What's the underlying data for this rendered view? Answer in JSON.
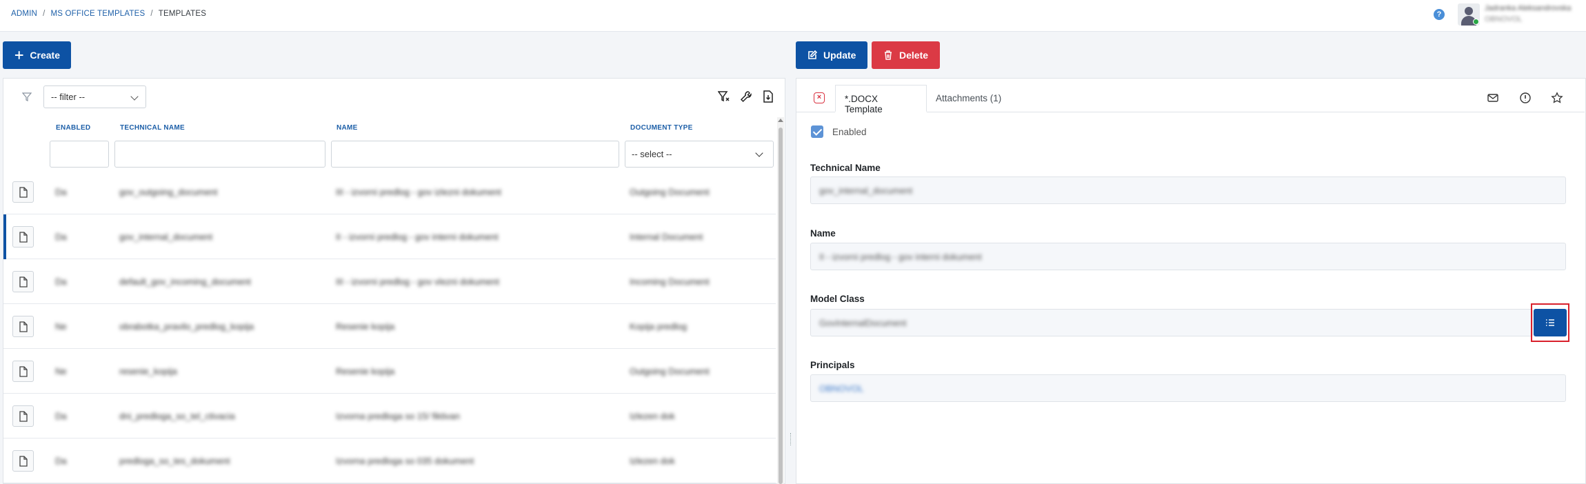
{
  "breadcrumb": {
    "item1": "ADMIN",
    "item2": "MS OFFICE TEMPLATES",
    "current": "TEMPLATES",
    "separator": "/"
  },
  "header": {
    "help_label": "?",
    "user_name": "Jadranka Aleksandrovska",
    "user_org": "OBNOVOL"
  },
  "toolbar": {
    "create_label": "Create",
    "update_label": "Update",
    "delete_label": "Delete"
  },
  "filter": {
    "value": "-- filter --"
  },
  "table": {
    "columns": {
      "enabled": "ENABLED",
      "technical_name": "TECHNICAL NAME",
      "name": "NAME",
      "document_type": "DOCUMENT TYPE"
    },
    "doc_type_select": "-- select --",
    "rows": [
      {
        "enabled": "Da",
        "technical_name": "gov_outgoing_document",
        "name": "III - izvorni predlog - gov izlezni dokument",
        "document_type": "Outgoing Document"
      },
      {
        "enabled": "Da",
        "technical_name": "gov_internal_document",
        "name": "II - izvorni predlog - gov interni dokument",
        "document_type": "Internal Document"
      },
      {
        "enabled": "Da",
        "technical_name": "default_gov_incoming_document",
        "name": "III - izvorni predlog - gov vlezni dokument",
        "document_type": "Incoming Document"
      },
      {
        "enabled": "Ne",
        "technical_name": "obrabotka_pravilo_predlog_kopija",
        "name": "Resenie kopija",
        "document_type": "Kopija predlog"
      },
      {
        "enabled": "Ne",
        "technical_name": "resenie_kopija",
        "name": "Resenie kopija",
        "document_type": "Outgoing Document"
      },
      {
        "enabled": "Da",
        "technical_name": "dni_predloga_so_tel_ctivacia",
        "name": "Izvorna predloga so 15/ fiktivan",
        "document_type": "Izlezen dok"
      },
      {
        "enabled": "Da",
        "technical_name": "predloga_so_tes_dokument",
        "name": "Izvorna predloga so 035 dokument",
        "document_type": "Izlezen dok"
      }
    ]
  },
  "detail": {
    "tabs": {
      "template": "*.DOCX Template",
      "attachments": "Attachments (1)"
    },
    "enabled_label": "Enabled",
    "technical_name": {
      "label": "Technical Name",
      "value": "gov_internal_document"
    },
    "name": {
      "label": "Name",
      "value": "II - izvorni predlog - gov interni dokument"
    },
    "model_class": {
      "label": "Model Class",
      "value": "GovInternalDocument"
    },
    "principals": {
      "label": "Principals",
      "value": "OBNOVOL"
    }
  },
  "colors": {
    "primary": "#0d52a4",
    "danger": "#db3a45",
    "link": "#1d5fa8",
    "highlight": "#d9202b"
  }
}
